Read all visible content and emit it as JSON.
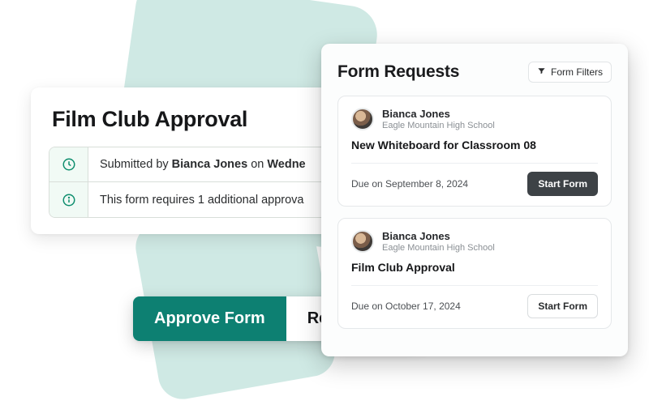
{
  "approval": {
    "title": "Film Club Approval",
    "submitted_prefix": "Submitted by ",
    "submitted_name": "Bianca Jones",
    "submitted_mid": " on ",
    "submitted_day": "Wedne",
    "requires_text": "This form requires 1 additional approva"
  },
  "actions": {
    "approve": "Approve Form",
    "reject": "Reject Form"
  },
  "requests": {
    "heading": "Form Requests",
    "filter_label": "Form Filters",
    "cards": [
      {
        "name": "Bianca Jones",
        "school": "Eagle Mountain High School",
        "title": "New Whiteboard for Classroom 08",
        "due": "Due on September 8, 2024",
        "cta": "Start Form",
        "cta_style": "dark"
      },
      {
        "name": "Bianca Jones",
        "school": "Eagle Mountain High School",
        "title": "Film Club Approval",
        "due": "Due on October 17, 2024",
        "cta": "Start Form",
        "cta_style": "light"
      }
    ]
  },
  "colors": {
    "accent": "#0d8072"
  }
}
